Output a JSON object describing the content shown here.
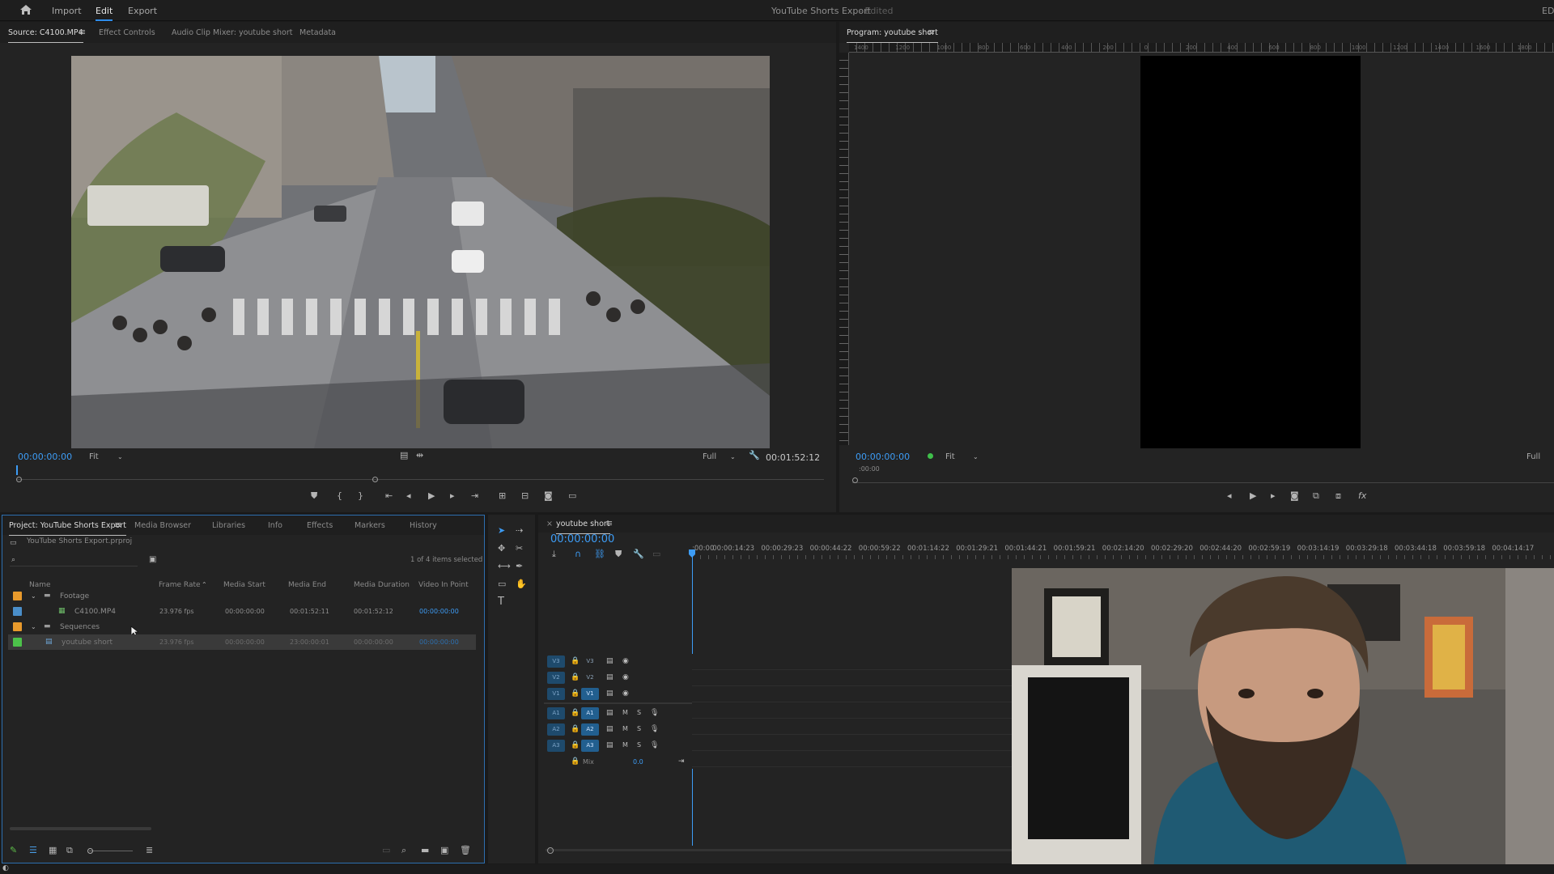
{
  "topbar": {
    "menu": [
      "Import",
      "Edit",
      "Export"
    ],
    "title": "YouTube Shorts Export",
    "title_state": "- Edited",
    "right_label": "EDI"
  },
  "source_monitor": {
    "tabs": [
      "Source: C4100.MP4",
      "Effect Controls",
      "Audio Clip Mixer: youtube short",
      "Metadata"
    ],
    "timecode": "00:00:00:00",
    "zoom": "Fit",
    "resolution": "Full",
    "duration": "00:01:52:12"
  },
  "program_monitor": {
    "tab": "Program: youtube short",
    "ruler_labels": [
      "1400",
      "1200",
      "1000",
      "800",
      "600",
      "400",
      "200",
      "0",
      "200",
      "400",
      "600",
      "800",
      "1000",
      "1200",
      "1400",
      "1600",
      "1800"
    ],
    "timecode": "00:00:00:00",
    "zoom": "Fit",
    "resolution": "Full",
    "scrub_label": ":00:00"
  },
  "project": {
    "tabs": [
      "Project: YouTube Shorts Export",
      "Media Browser",
      "Libraries",
      "Info",
      "Effects",
      "Markers",
      "History"
    ],
    "file": "YouTube Shorts Export.prproj",
    "selection": "1 of 4 items selected",
    "columns": [
      "Name",
      "Frame Rate",
      "Media Start",
      "Media End",
      "Media Duration",
      "Video In Point"
    ],
    "rows": [
      {
        "name": "Footage",
        "type": "bin",
        "color": "#e89a2c",
        "frame_rate": "",
        "start": "",
        "end": "",
        "duration": "",
        "in_point": ""
      },
      {
        "name": "C4100.MP4",
        "type": "clip",
        "color": "#4a8ec9",
        "frame_rate": "23.976 fps",
        "start": "00:00:00:00",
        "end": "00:01:52:11",
        "duration": "00:01:52:12",
        "in_point": "00:00:00:00"
      },
      {
        "name": "Sequences",
        "type": "bin",
        "color": "#e89a2c",
        "frame_rate": "",
        "start": "",
        "end": "",
        "duration": "",
        "in_point": ""
      },
      {
        "name": "youtube short",
        "type": "sequence",
        "color": "#4cc24a",
        "frame_rate": "23.976 fps",
        "start": "00:00:00:00",
        "end": "23:00:00:01",
        "duration": "00:00:00:00",
        "in_point": "00:00:00:00"
      }
    ]
  },
  "timeline": {
    "sequence_name": "youtube short",
    "timecode": "00:00:00:00",
    "ruler": [
      ":00:00",
      "00:00:14:23",
      "00:00:29:23",
      "00:00:44:22",
      "00:00:59:22",
      "00:01:14:22",
      "00:01:29:21",
      "00:01:44:21",
      "00:01:59:21",
      "00:02:14:20",
      "00:02:29:20",
      "00:02:44:20",
      "00:02:59:19",
      "00:03:14:19",
      "00:03:29:18",
      "00:03:44:18",
      "00:03:59:18",
      "00:04:14:17"
    ],
    "video_tracks": [
      "V3",
      "V2",
      "V1"
    ],
    "audio_tracks": [
      "A1",
      "A2",
      "A3"
    ],
    "mix_label": "Mix",
    "mix_value": "0.0"
  },
  "icons": {
    "home": "home-icon",
    "search": "search-icon",
    "play": "play-icon",
    "wrench": "wrench-icon"
  },
  "colors": {
    "accent": "#2d8ceb",
    "timecode": "#3d9cf5",
    "track_enabled": "#225f8f"
  }
}
